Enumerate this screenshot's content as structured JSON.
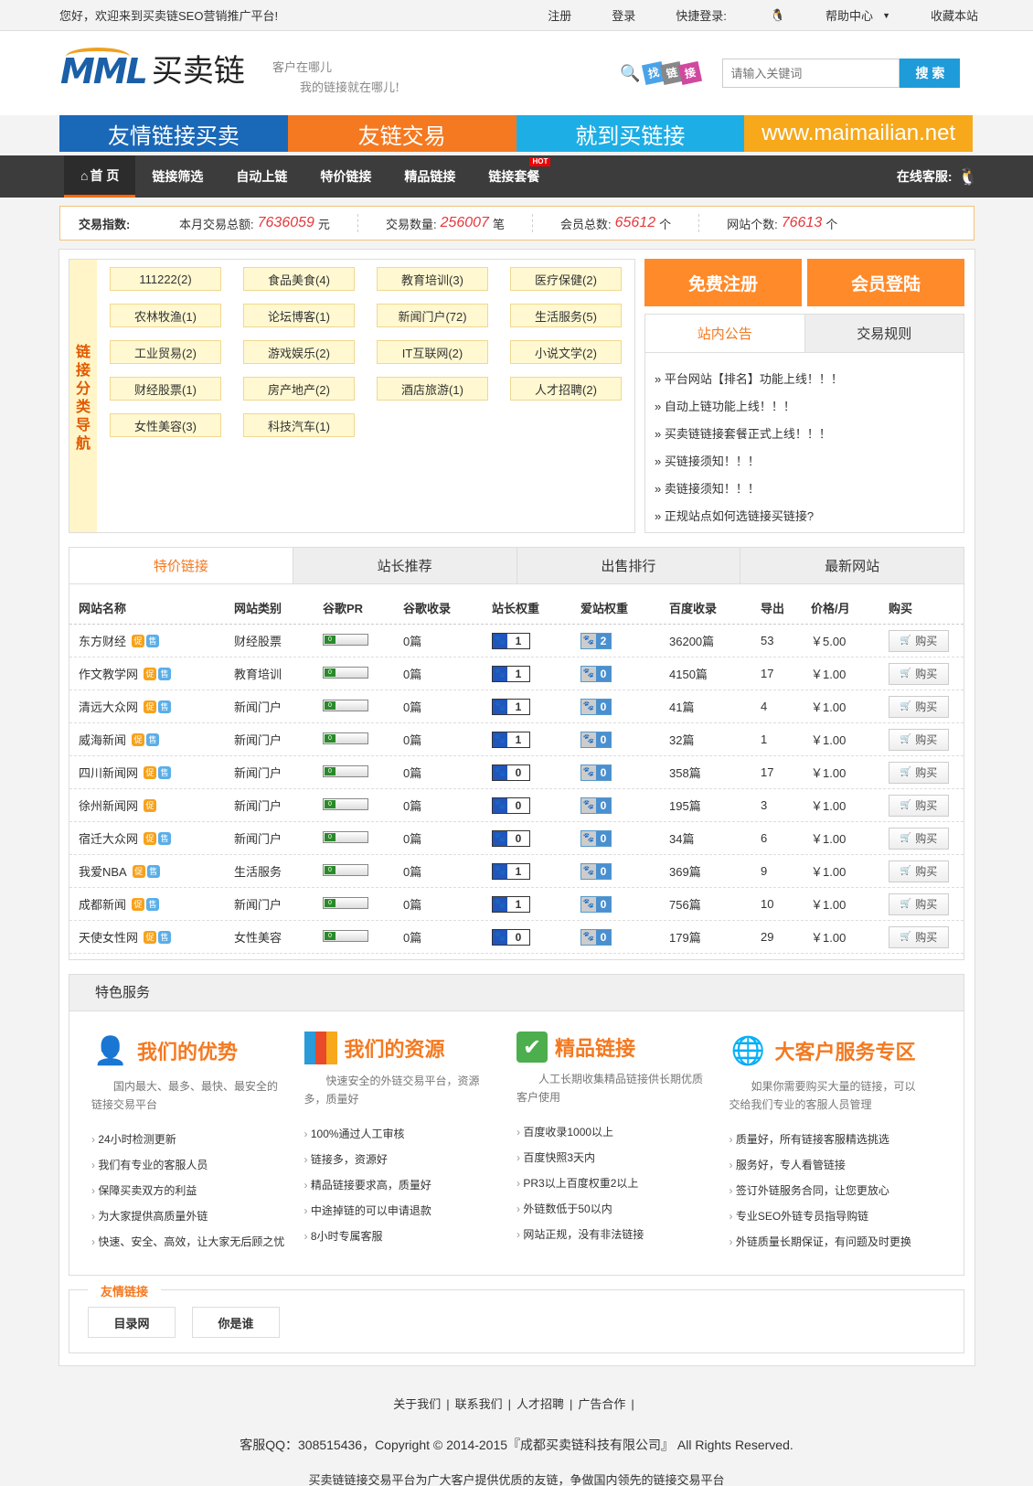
{
  "topbar": {
    "welcome": "您好，欢迎来到买卖链SEO营销推广平台!",
    "links": [
      "注册",
      "登录",
      "快捷登录:",
      "帮助中心",
      "收藏本站"
    ]
  },
  "header": {
    "logo_mml": "MML",
    "logo_cn": "买卖链",
    "slogan_1": "客户在哪儿",
    "slogan_2": "我的链接就在哪儿!",
    "tags": [
      "找",
      "链",
      "接"
    ],
    "search_placeholder": "请输入关键词",
    "search_button": "搜 索"
  },
  "banner": {
    "segments": [
      "友情链接买卖",
      "友链交易",
      "就到买链接",
      "www.maimailian.net"
    ],
    "colors": [
      "#1a68b8",
      "#f47920",
      "#1eaee6",
      "#f7a81b"
    ]
  },
  "nav": {
    "items": [
      "首 页",
      "链接筛选",
      "自动上链",
      "特价链接",
      "精品链接",
      "链接套餐"
    ],
    "hot_badge": "HOT",
    "online_service": "在线客服:"
  },
  "stats": {
    "label": "交易指数:",
    "items": [
      {
        "label": "本月交易总额:",
        "value": "7636059",
        "unit": "元"
      },
      {
        "label": "交易数量:",
        "value": "256007",
        "unit": "笔"
      },
      {
        "label": "会员总数:",
        "value": "65612",
        "unit": "个"
      },
      {
        "label": "网站个数:",
        "value": "76613",
        "unit": "个"
      }
    ]
  },
  "categories": {
    "side_title": "链接分类导航",
    "items": [
      "111222(2)",
      "食品美食(4)",
      "教育培训(3)",
      "医疗保健(2)",
      "农林牧渔(1)",
      "论坛博客(1)",
      "新闻门户(72)",
      "生活服务(5)",
      "工业贸易(2)",
      "游戏娱乐(2)",
      "IT互联网(2)",
      "小说文学(2)",
      "财经股票(1)",
      "房产地产(2)",
      "酒店旅游(1)",
      "人才招聘(2)",
      "女性美容(3)",
      "科技汽车(1)"
    ]
  },
  "actions": {
    "register": "免费注册",
    "login": "会员登陆"
  },
  "notice": {
    "tabs": [
      "站内公告",
      "交易规则"
    ],
    "items": [
      "» 平台网站【排名】功能上线！！！",
      "» 自动上链功能上线！！！",
      "» 买卖链链接套餐正式上线！！！",
      "» 买链接须知！！！",
      "» 卖链接须知！！！",
      "» 正规站点如何选链接买链接?"
    ]
  },
  "table": {
    "tabs": [
      "特价链接",
      "站长推荐",
      "出售排行",
      "最新网站"
    ],
    "headers": [
      "网站名称",
      "网站类别",
      "谷歌PR",
      "谷歌收录",
      "站长权重",
      "爱站权重",
      "百度收录",
      "导出",
      "价格/月",
      "购买"
    ],
    "badge_promo": "促",
    "badge_sale": "售",
    "buy_label": "购买",
    "rows": [
      {
        "name": "东方财经",
        "cat": "财经股票",
        "pr": "0",
        "google": "0篇",
        "zz": "1",
        "az": "2",
        "baidu": "36200篇",
        "out": "53",
        "price": "￥5.00",
        "sale": true
      },
      {
        "name": "作文教学网",
        "cat": "教育培训",
        "pr": "0",
        "google": "0篇",
        "zz": "1",
        "az": "0",
        "baidu": "4150篇",
        "out": "17",
        "price": "￥1.00",
        "sale": true
      },
      {
        "name": "清远大众网",
        "cat": "新闻门户",
        "pr": "0",
        "google": "0篇",
        "zz": "1",
        "az": "0",
        "baidu": "41篇",
        "out": "4",
        "price": "￥1.00",
        "sale": true
      },
      {
        "name": "威海新闻",
        "cat": "新闻门户",
        "pr": "0",
        "google": "0篇",
        "zz": "1",
        "az": "0",
        "baidu": "32篇",
        "out": "1",
        "price": "￥1.00",
        "sale": true
      },
      {
        "name": "四川新闻网",
        "cat": "新闻门户",
        "pr": "0",
        "google": "0篇",
        "zz": "0",
        "az": "0",
        "baidu": "358篇",
        "out": "17",
        "price": "￥1.00",
        "sale": true
      },
      {
        "name": "徐州新闻网",
        "cat": "新闻门户",
        "pr": "0",
        "google": "0篇",
        "zz": "0",
        "az": "0",
        "baidu": "195篇",
        "out": "3",
        "price": "￥1.00",
        "sale": false
      },
      {
        "name": "宿迁大众网",
        "cat": "新闻门户",
        "pr": "0",
        "google": "0篇",
        "zz": "0",
        "az": "0",
        "baidu": "34篇",
        "out": "6",
        "price": "￥1.00",
        "sale": true
      },
      {
        "name": "我爱NBA",
        "cat": "生活服务",
        "pr": "0",
        "google": "0篇",
        "zz": "1",
        "az": "0",
        "baidu": "369篇",
        "out": "9",
        "price": "￥1.00",
        "sale": true
      },
      {
        "name": "成都新闻",
        "cat": "新闻门户",
        "pr": "0",
        "google": "0篇",
        "zz": "1",
        "az": "0",
        "baidu": "756篇",
        "out": "10",
        "price": "￥1.00",
        "sale": true
      },
      {
        "name": "天使女性网",
        "cat": "女性美容",
        "pr": "0",
        "google": "0篇",
        "zz": "0",
        "az": "0",
        "baidu": "179篇",
        "out": "29",
        "price": "￥1.00",
        "sale": true
      }
    ]
  },
  "services": {
    "title": "特色服务",
    "cols": [
      {
        "icon": "user-check-icon",
        "title": "我们的优势",
        "desc": "国内最大、最多、最快、最安全的链接交易平台",
        "items": [
          "24小时检测更新",
          "我们有专业的客服人员",
          "保障买卖双方的利益",
          "为大家提供高质量外链",
          "快速、安全、高效，让大家无后顾之忧"
        ]
      },
      {
        "icon": "bar-chart-icon",
        "title": "我们的资源",
        "desc": "快速安全的外链交易平台，资源多，质量好",
        "items": [
          "100%通过人工审核",
          "链接多，资源好",
          "精品链接要求高，质量好",
          "中途掉链的可以申请退款",
          "8小时专属客服"
        ]
      },
      {
        "icon": "check-box-icon",
        "title": "精品链接",
        "desc": "人工长期收集精品链接供长期优质客户使用",
        "items": [
          "百度收录1000以上",
          "百度快照3天内",
          "PR3以上百度权重2以上",
          "外链数低于50以内",
          "网站正规，没有非法链接"
        ]
      },
      {
        "icon": "globe-search-icon",
        "title": "大客户服务专区",
        "desc": "如果你需要购买大量的链接，可以交给我们专业的客服人员管理",
        "items": [
          "质量好，所有链接客服精选挑选",
          "服务好，专人看管链接",
          "签订外链服务合同，让您更放心",
          "专业SEO外链专员指导购链",
          "外链质量长期保证，有问题及时更换"
        ]
      }
    ]
  },
  "friend_links": {
    "title": "友情链接",
    "items": [
      "目录网",
      "你是谁"
    ]
  },
  "footer": {
    "links": [
      "关于我们",
      "联系我们",
      "人才招聘",
      "广告合作"
    ],
    "copyright": "客服QQ：308515436，Copyright © 2014-2015『成都买卖链科技有限公司』 All Rights Reserved.",
    "slogan": "买卖链链接交易平台为广大客户提供优质的友链，争做国内领先的链接交易平台"
  }
}
